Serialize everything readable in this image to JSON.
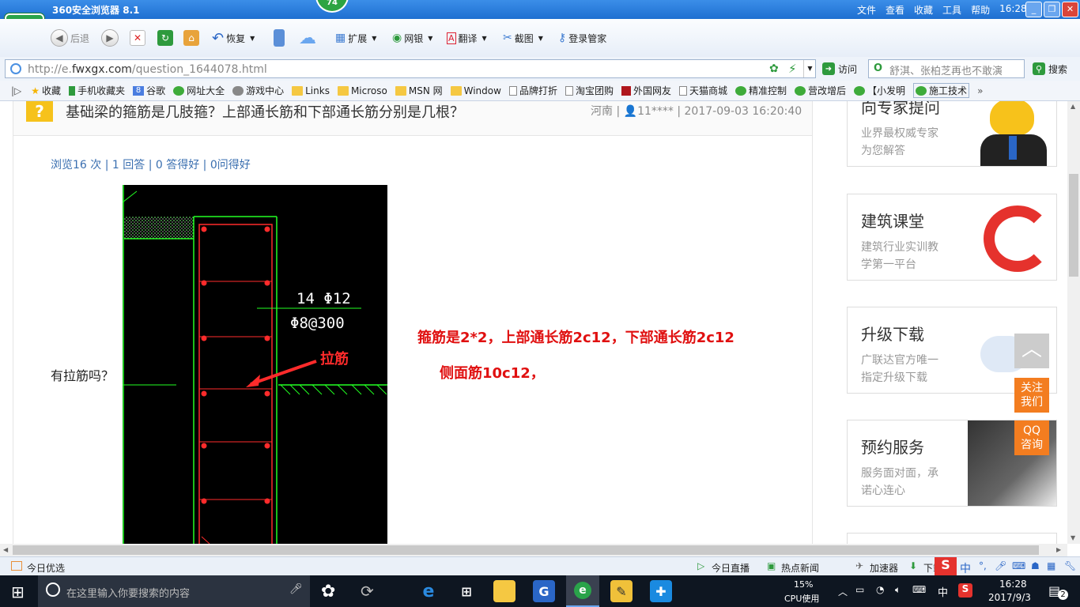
{
  "window": {
    "title": "360安全浏览器 8.1",
    "badge": "74",
    "menu": [
      "文件",
      "查看",
      "收藏",
      "工具",
      "帮助"
    ],
    "clock": "16:28"
  },
  "toolbar": {
    "back": "后退",
    "restore": "恢复",
    "extend": "扩展",
    "netbank": "网银",
    "translate": "翻译",
    "screenshot": "截图",
    "login_manager": "登录管家"
  },
  "address": {
    "url_prefix": "http://e.",
    "url_domain": "fwxgx.com",
    "url_path": "/question_1644078.html",
    "go": "访问",
    "search_placeholder": "舒淇、张柏芝再也不敢演",
    "search_button": "搜索"
  },
  "bookmarks": [
    "收藏",
    "手机收藏夹",
    "谷歌",
    "网址大全",
    "游戏中心",
    "Links",
    "Microso",
    "MSN 网",
    "Window",
    "品牌打折",
    "淘宝团购",
    "外国网友",
    "天猫商城",
    "精准控制",
    "营改增后",
    "【小发明",
    "施工技术"
  ],
  "question": {
    "title": "基础梁的箍筋是几肢箍？上部通长筋和下部通长筋分别是几根？",
    "location": "河南",
    "user": "11****",
    "datetime": "2017-09-03 16:20:40",
    "stats": "浏览16 次 | 1 回答 | 0 答得好 | 0问得好",
    "body": "有拉筋吗？"
  },
  "drawing": {
    "rebar_top": "14 Φ12",
    "stirrup": "Φ8@300",
    "tie_label": "拉筋"
  },
  "answer": {
    "line1": "箍筋是2*2，上部通长筋2c12，下部通长筋2c12",
    "line2": "侧面筋10c12，"
  },
  "sidebar": {
    "cards": [
      {
        "title": "向专家提问",
        "desc1": "业界最权威专家",
        "desc2": "为您解答"
      },
      {
        "title": "建筑课堂",
        "desc1": "建筑行业实训教",
        "desc2": "学第一平台"
      },
      {
        "title": "升级下载",
        "desc1": "广联达官方唯一",
        "desc2": "指定升级下载"
      },
      {
        "title": "预约服务",
        "desc1": "服务面对面，承",
        "desc2": "诺心连心"
      }
    ],
    "follow_1": "关注",
    "follow_2": "我们",
    "qq_1": "QQ",
    "qq_2": "咨询"
  },
  "statusbar": {
    "left": "今日优选",
    "live": "今日直播",
    "hotnews": "热点新闻",
    "accelerator": "加速器",
    "download": "下载"
  },
  "taskbar": {
    "search_placeholder": "在这里输入你要搜索的内容",
    "cpu_percent": "15%",
    "cpu_label": "CPU使用",
    "ime": "中",
    "time": "16:28",
    "date": "2017/9/3",
    "notifications": "2"
  }
}
